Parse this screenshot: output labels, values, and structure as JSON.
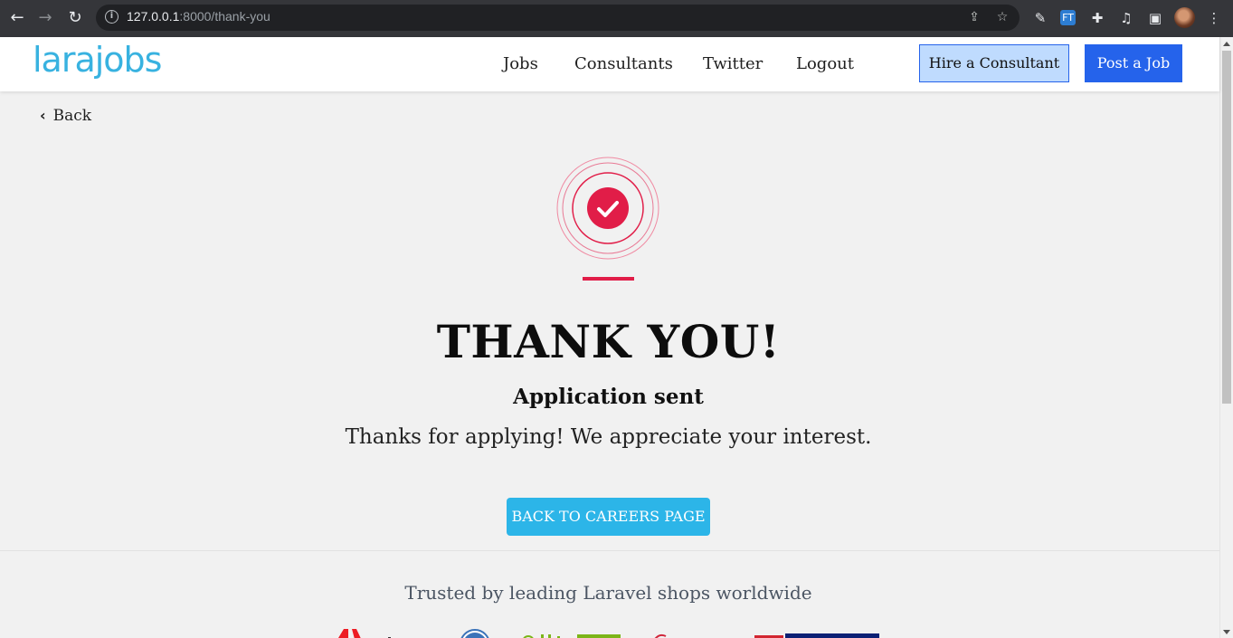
{
  "browser": {
    "url_host": "127.0.0.1",
    "url_path": ":8000/thank-you",
    "ext_label": "FT"
  },
  "site": {
    "logo": "larajobs",
    "nav": [
      "Jobs",
      "Consultants",
      "Twitter",
      "Logout"
    ],
    "hire_label": "Hire a Consultant",
    "post_label": "Post a Job"
  },
  "page": {
    "back_label": "Back",
    "title": "THANK YOU!",
    "subtitle": "Application sent",
    "message": "Thanks for applying! We appreciate your interest.",
    "cta_label": "BACK TO CAREERS PAGE",
    "trusted_text": "Trusted by leading Laravel shops worldwide"
  },
  "colors": {
    "accent_red": "#e11d48",
    "brand_blue": "#38b2e0",
    "primary_blue": "#2563eb",
    "cta_blue": "#2cb5e8"
  }
}
